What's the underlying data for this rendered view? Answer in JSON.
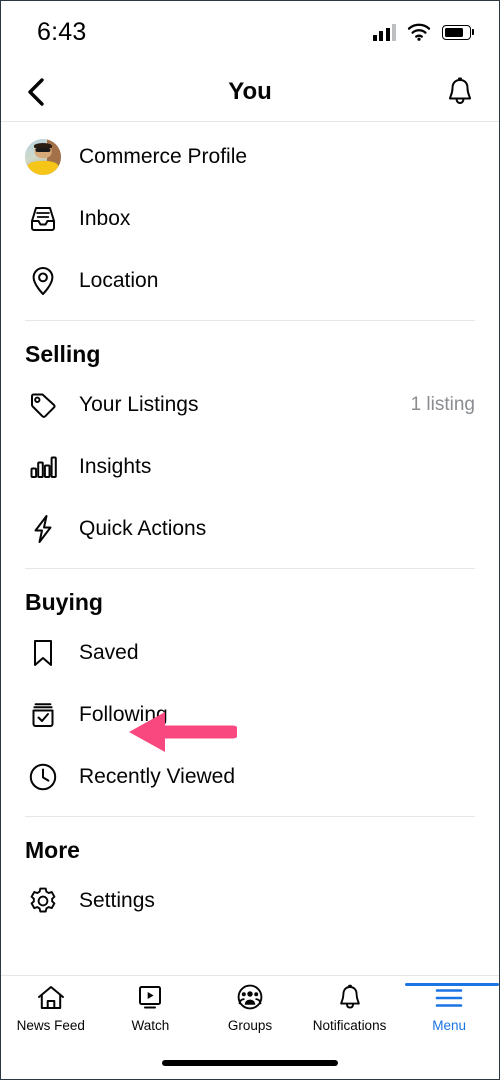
{
  "status_bar": {
    "time": "6:43",
    "signal_icon": "cellular-signal-icon",
    "wifi_icon": "wifi-icon",
    "battery_icon": "battery-icon"
  },
  "header": {
    "back_icon": "back-chevron-icon",
    "title": "You",
    "bell_icon": "notifications-bell-icon"
  },
  "menu": {
    "top_items": [
      {
        "label": "Commerce Profile",
        "icon": "user-avatar",
        "meta": ""
      },
      {
        "label": "Inbox",
        "icon": "inbox-tray-icon",
        "meta": ""
      },
      {
        "label": "Location",
        "icon": "location-pin-icon",
        "meta": ""
      }
    ],
    "sections": [
      {
        "title": "Selling",
        "items": [
          {
            "label": "Your Listings",
            "icon": "price-tag-icon",
            "meta": "1 listing"
          },
          {
            "label": "Insights",
            "icon": "bar-chart-icon",
            "meta": ""
          },
          {
            "label": "Quick Actions",
            "icon": "lightning-bolt-icon",
            "meta": ""
          }
        ]
      },
      {
        "title": "Buying",
        "items": [
          {
            "label": "Saved",
            "icon": "bookmark-icon",
            "meta": ""
          },
          {
            "label": "Following",
            "icon": "box-check-icon",
            "meta": ""
          },
          {
            "label": "Recently Viewed",
            "icon": "clock-icon",
            "meta": ""
          }
        ]
      },
      {
        "title": "More",
        "items": [
          {
            "label": "Settings",
            "icon": "gear-icon",
            "meta": ""
          }
        ]
      }
    ]
  },
  "annotation": {
    "type": "left-pointing-arrow",
    "color": "#f9487f",
    "points_at": "Saved"
  },
  "tabbar": {
    "active": "Menu",
    "accent_color": "#1b74e4",
    "items": [
      {
        "label": "News Feed",
        "icon": "home-icon"
      },
      {
        "label": "Watch",
        "icon": "watch-play-icon"
      },
      {
        "label": "Groups",
        "icon": "groups-people-icon"
      },
      {
        "label": "Notifications",
        "icon": "bell-icon"
      },
      {
        "label": "Menu",
        "icon": "hamburger-menu-icon"
      }
    ]
  }
}
